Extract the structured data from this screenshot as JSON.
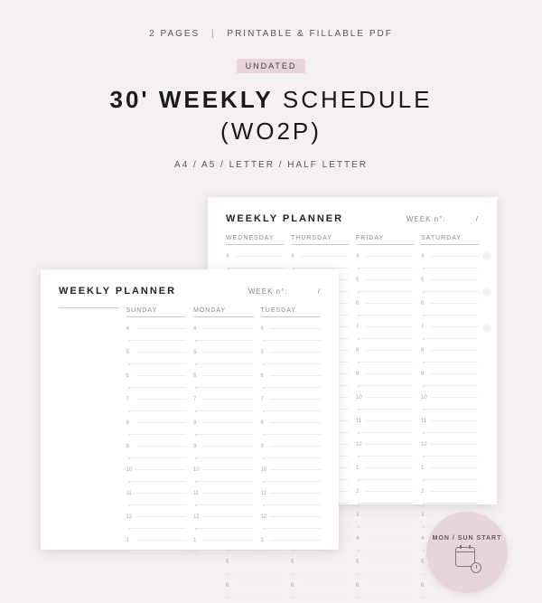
{
  "header": {
    "pages_text": "2 PAGES",
    "format_text": "PRINTABLE  &  FILLABLE PDF",
    "undated_label": "UNDATED",
    "title_bold": "30' WEEKLY",
    "title_light": " SCHEDULE",
    "subtitle": "(WO2P)",
    "sizes": "A4 / A5 / LETTER / HALF LETTER"
  },
  "page_shared": {
    "title": "WEEKLY PLANNER",
    "week_label": "WEEK n°:",
    "week_slash": "/"
  },
  "page_back": {
    "days": [
      "WEDNESDAY",
      "THURSDAY",
      "FRIDAY",
      "SATURDAY"
    ],
    "hours": [
      "4",
      "5",
      "6",
      "7",
      "8",
      "9",
      "10",
      "11",
      "12",
      "1",
      "2",
      "3",
      "4",
      "5",
      "6"
    ]
  },
  "page_front": {
    "days": [
      "SUNDAY",
      "MONDAY",
      "TUESDAY"
    ],
    "hours": [
      "4",
      "5",
      "6",
      "7",
      "8",
      "9",
      "10",
      "11",
      "12",
      "1"
    ]
  },
  "badge": {
    "text": "MON / SUN START"
  }
}
